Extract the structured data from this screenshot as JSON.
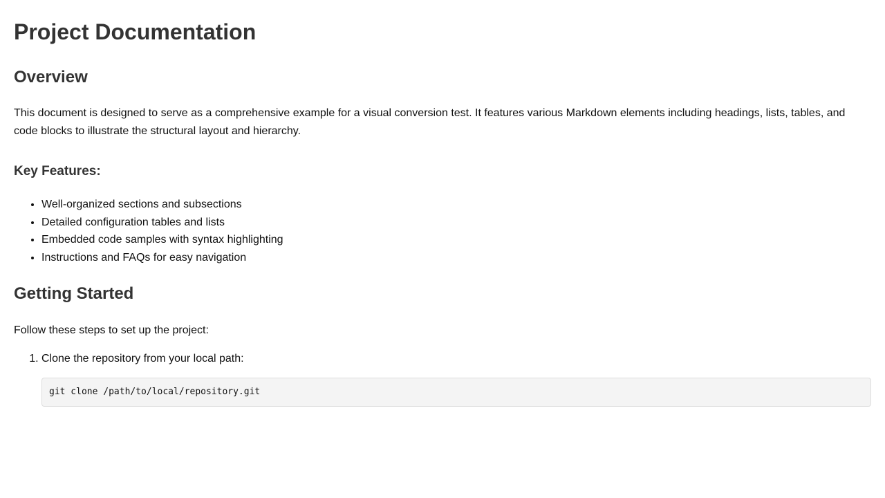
{
  "doc": {
    "title": "Project Documentation",
    "overview": {
      "heading": "Overview",
      "text": "This document is designed to serve as a comprehensive example for a visual conversion test. It features various Markdown elements including headings, lists, tables, and code blocks to illustrate the structural layout and hierarchy."
    },
    "features": {
      "heading": "Key Features:",
      "items": [
        "Well-organized sections and subsections",
        "Detailed configuration tables and lists",
        "Embedded code samples with syntax highlighting",
        "Instructions and FAQs for easy navigation"
      ]
    },
    "getting_started": {
      "heading": "Getting Started",
      "text": "Follow these steps to set up the project:",
      "steps": [
        {
          "text": "Clone the repository from your local path:",
          "code": "git clone /path/to/local/repository.git"
        }
      ]
    }
  }
}
